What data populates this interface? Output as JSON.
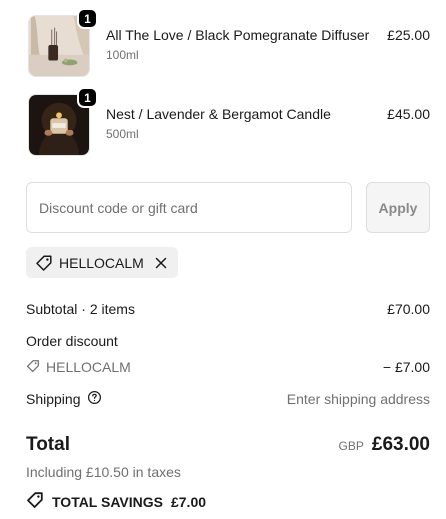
{
  "line_items": [
    {
      "quantity": "1",
      "name": "All The Love / Black Pomegranate Diffuser",
      "variant": "100ml",
      "price": "£25.00",
      "image": "diffuser-thumbnail"
    },
    {
      "quantity": "1",
      "name": "Nest / Lavender & Bergamot Candle",
      "variant": "500ml",
      "price": "£45.00",
      "image": "candle-thumbnail"
    }
  ],
  "discount": {
    "placeholder": "Discount code or gift card",
    "apply_label": "Apply",
    "applied_code": "HELLOCALM",
    "tag_icon": "tag-icon",
    "remove_icon": "close-icon"
  },
  "summary": {
    "subtotal_label": "Subtotal · 2 items",
    "subtotal_value": "£70.00",
    "order_discount_label": "Order discount",
    "order_discount_code": "HELLOCALM",
    "order_discount_value": "− £7.00",
    "shipping_label": "Shipping",
    "shipping_value": "Enter shipping address",
    "total_label": "Total",
    "currency": "GBP",
    "total_value": "£63.00",
    "taxes_note": "Including £10.50 in taxes",
    "savings_label": "TOTAL SAVINGS",
    "savings_value": "£7.00"
  }
}
